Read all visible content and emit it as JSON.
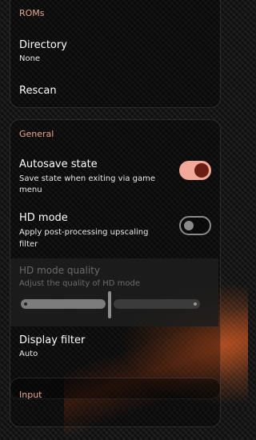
{
  "sections": {
    "roms": {
      "header": "ROMs",
      "directory": {
        "title": "Directory",
        "subtitle": "None"
      },
      "rescan": {
        "title": "Rescan"
      }
    },
    "general": {
      "header": "General",
      "autosave": {
        "title": "Autosave state",
        "subtitle_line1": "Save state when exiting via game",
        "subtitle_line2": "menu",
        "enabled": true
      },
      "hd_mode": {
        "title": "HD mode",
        "subtitle_line1": "Apply post-processing upscaling",
        "subtitle_line2": "filter",
        "enabled": false
      },
      "hd_quality": {
        "title": "HD mode quality",
        "subtitle": "Adjust the quality of HD mode",
        "value_fraction": 0.5,
        "disabled": true
      },
      "display_filter": {
        "title": "Display filter",
        "subtitle": "Auto"
      }
    },
    "input": {
      "header": "Input"
    }
  },
  "colors": {
    "accent": "#e8a58e",
    "toggle_on_track": "#f3a99a",
    "toggle_on_knob": "#6b1d14"
  }
}
